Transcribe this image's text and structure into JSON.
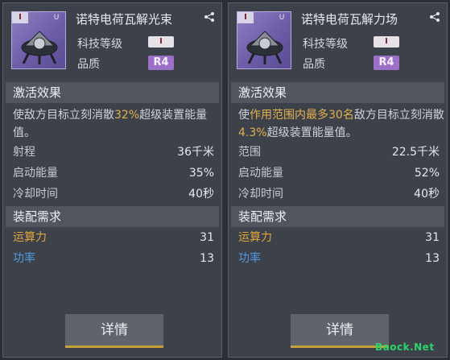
{
  "cards": [
    {
      "title": "诺特电荷瓦解光束",
      "tag": "I",
      "grade_mark": "U",
      "tech_level_label": "科技等级",
      "tech_level_value": "I",
      "quality_label": "品质",
      "quality_value": "R4",
      "effect_title": "激活效果",
      "desc_parts": [
        "使敌方目标立刻消散",
        "32%",
        "超级装置能量值。"
      ],
      "stats": [
        {
          "label": "射程",
          "value": "36千米"
        },
        {
          "label": "启动能量",
          "value": "35%"
        },
        {
          "label": "冷却时间",
          "value": "40秒"
        }
      ],
      "req_title": "装配需求",
      "reqs": [
        {
          "label": "运算力",
          "value": "31"
        },
        {
          "label": "功率",
          "value": "13"
        }
      ],
      "detail_button": "详情"
    },
    {
      "title": "诺特电荷瓦解力场",
      "tag": "I",
      "grade_mark": "U",
      "tech_level_label": "科技等级",
      "tech_level_value": "I",
      "quality_label": "品质",
      "quality_value": "R4",
      "effect_title": "激活效果",
      "desc_parts": [
        "使",
        "作用范围内最多30名",
        "敌方目标立刻消散",
        "4.3%",
        "超级装置能量值。"
      ],
      "stats": [
        {
          "label": "范围",
          "value": "22.5千米"
        },
        {
          "label": "启动能量",
          "value": "52%"
        },
        {
          "label": "冷却时间",
          "value": "40秒"
        }
      ],
      "req_title": "装配需求",
      "reqs": [
        {
          "label": "运算力",
          "value": "31"
        },
        {
          "label": "功率",
          "value": "13"
        }
      ],
      "detail_button": "详情"
    }
  ],
  "icons": {
    "share": "share-icon",
    "ship": "ship-icon"
  },
  "watermark": "Baock.Net",
  "colors": {
    "highlight": "#e3b24b",
    "compute": "#e0a83b",
    "power": "#4f9ae0",
    "quality": "#9c70c9"
  }
}
